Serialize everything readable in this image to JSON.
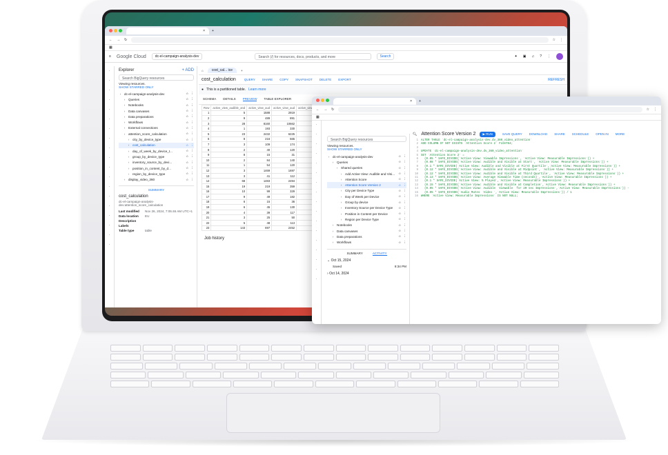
{
  "back_window": {
    "tab_title": "×",
    "url": "",
    "logo": "Google Cloud",
    "project": "dc-el-campaign-analysis-dev",
    "search_placeholder": "Search (/) for resources, docs, products, and more",
    "search_button": "Search",
    "explorer_title": "Explorer",
    "add_label": "+ ADD",
    "explorer_search": "Search BigQuery resources",
    "viewing": "Viewing resources.",
    "show_starred": "SHOW STARRED ONLY",
    "tree": [
      {
        "label": "dc-el-campaign-analysis-dev",
        "indent": 0
      },
      {
        "label": "Queries",
        "indent": 1
      },
      {
        "label": "Notebooks",
        "indent": 1
      },
      {
        "label": "Data canvases",
        "indent": 1
      },
      {
        "label": "Data preparations",
        "indent": 1
      },
      {
        "label": "Workflows",
        "indent": 1
      },
      {
        "label": "External connections",
        "indent": 1
      },
      {
        "label": "attention_score_calculation",
        "indent": 1
      },
      {
        "label": "city_by_device_type",
        "indent": 2
      },
      {
        "label": "cost_calculation",
        "indent": 2,
        "selected": true
      },
      {
        "label": "day_of_week_by_device_t...",
        "indent": 2
      },
      {
        "label": "group_by_device_type",
        "indent": 2
      },
      {
        "label": "inventory_source_by_devi...",
        "indent": 2
      },
      {
        "label": "position_in_content_by_d...",
        "indent": 2
      },
      {
        "label": "region_by_device_type",
        "indent": 2
      },
      {
        "label": "display_video_360",
        "indent": 1
      }
    ],
    "summary_tab": "SUMMARY",
    "summary_title": "cost_calculation",
    "summary_path": "dc-el-campaign-analysis-dev:attention_score_calculation",
    "details": [
      {
        "k": "Last modified",
        "v": "Nov 26, 2024, 7:05:46 AM UTC+1"
      },
      {
        "k": "Data location",
        "v": "EU"
      },
      {
        "k": "Description",
        "v": ""
      },
      {
        "k": "Labels",
        "v": ""
      },
      {
        "k": "Table type",
        "v": "table"
      }
    ],
    "tab_label": "cost_cal... ice",
    "table_title": "cost_calculation",
    "actions": [
      "QUERY",
      "SHARE",
      "COPY",
      "SNAPSHOT",
      "DELETE",
      "EXPORT"
    ],
    "refresh": "REFRESH",
    "partition_note": "This is a partitioned table.",
    "learn_more": "Learn more",
    "subtabs": [
      "SCHEMA",
      "DETAILS",
      "PREVIEW",
      "TABLE EXPLORER"
    ],
    "columns": [
      "Row",
      "active_view_audible_and",
      "active_view_aud",
      "active_view_aud",
      "active_view"
    ],
    "rows": [
      [
        "1",
        "5",
        "1588",
        "2919"
      ],
      [
        "2",
        "9",
        "489",
        "891"
      ],
      [
        "3",
        "28",
        "8160",
        "10662"
      ],
      [
        "4",
        "1",
        "193",
        "330"
      ],
      [
        "5",
        "23",
        "2432",
        "6225"
      ],
      [
        "6",
        "8",
        "216",
        "565"
      ],
      [
        "7",
        "3",
        "109",
        "174"
      ],
      [
        "8",
        "2",
        "40",
        "120"
      ],
      [
        "9",
        "8",
        "15",
        "31"
      ],
      [
        "10",
        "2",
        "84",
        "140"
      ],
      [
        "11",
        "1",
        "54",
        "120"
      ],
      [
        "12",
        "3",
        "1469",
        "1697"
      ],
      [
        "13",
        "3",
        "41",
        "112"
      ],
      [
        "14",
        "68",
        "1483",
        "2494"
      ],
      [
        "15",
        "19",
        "219",
        "359"
      ],
      [
        "16",
        "10",
        "99",
        "329"
      ],
      [
        "17",
        "9",
        "49",
        "182"
      ],
      [
        "18",
        "6",
        "15",
        "36"
      ],
      [
        "19",
        "6",
        "45",
        "130"
      ],
      [
        "20",
        "4",
        "39",
        "117"
      ],
      [
        "21",
        "3",
        "25",
        "50"
      ],
      [
        "22",
        "5",
        "48",
        "113"
      ],
      [
        "23",
        "143",
        "697",
        "2452"
      ]
    ],
    "job_history": "Job history"
  },
  "front_window": {
    "url": "",
    "explorer_search": "Search BigQuery resources",
    "viewing": "Viewing resources.",
    "show_starred": "SHOW STARRED ONLY",
    "tree": [
      {
        "label": "dc-el-campaign-analysis-dev",
        "indent": 0
      },
      {
        "label": "Queries",
        "indent": 1
      },
      {
        "label": "Shared queries",
        "indent": 2
      },
      {
        "label": "Add Active View: Audible and Visible ...",
        "indent": 3
      },
      {
        "label": "Attention Score",
        "indent": 3
      },
      {
        "label": "Attention Score Version 2",
        "indent": 3,
        "selected": true
      },
      {
        "label": "City per Device Type",
        "indent": 3
      },
      {
        "label": "Day of Week per Device",
        "indent": 3
      },
      {
        "label": "Group by device",
        "indent": 3
      },
      {
        "label": "Inventory Source per Device Type",
        "indent": 3
      },
      {
        "label": "Position in Content per Device",
        "indent": 3
      },
      {
        "label": "Region per Device Type",
        "indent": 3
      },
      {
        "label": "Notebooks",
        "indent": 1
      },
      {
        "label": "Data canvases",
        "indent": 1
      },
      {
        "label": "Data preparations",
        "indent": 1
      },
      {
        "label": "Workflows",
        "indent": 1
      }
    ],
    "summary_tab": "SUMMARY",
    "activity_tab": "ACTIVITY",
    "dates": [
      {
        "label": "Oct 15, 2024"
      },
      {
        "label": "Oct 14, 2024"
      }
    ],
    "saved_label": "Saved",
    "saved_time": "8:34 PM",
    "query_title": "Attention Score Version 2",
    "run": "RUN",
    "actions": [
      "SAVE QUERY",
      "DOWNLOAD",
      "SHARE",
      "SCHEDULE",
      "OPEN IN",
      "MORE"
    ],
    "code": [
      "ALTER TABLE `dc-el-campaign-analysis-dev.dv_360_video_attention`",
      "ADD COLUMN IF NOT EXISTS `Attention Score 2` FLOAT64;",
      "",
      "UPDATE `dc-el-campaign-analysis-dev.dv_360_video_attention`",
      "SET `Attention Score 2` =",
      "  (0.05 * SAFE_DIVIDE(`Active View: Viewable Impressions`, `Active View: Measurable Impressions`)) +",
      "  (0.08 * SAFE_DIVIDE(`Active View: Audible and Visible at Start`, `Active View: Measurable Impressions`)) +",
      "  (0.1 * SAFE_DIVIDE(`Active View: Audible and Visible at First Quartile`,`Active View: Measurable Impressions`)) +",
      "  (0.12 * SAFE_DIVIDE(`Active View: Audible and Visible at Midpoint`, `Active View: Measurable Impressions`)) +",
      "  (0.12 * SAFE_DIVIDE(`Active View: Audible and Visible at Third Quartile`, `Active View: Measurable Impressions`)) +",
      "  (0.13 * SAFE_DIVIDE(`Active View: Average Viewable Time (seconds)`,`Active View: Measurable Impressions`)) +",
      "  (0.1 * SAFE_DIVIDE(`Active View: % Played`,`Active View: Measurable Impressions`)) +",
      "  (0.15 * SAFE_DIVIDE(`Active View: Audible and Visible at Completion`,`Active View: Measurable Impressions`)) +",
      "  (0.05 * SAFE_DIVIDE(`Active View: Audible  Viewable  for 20 sec Impressions`,`Active View: Measurable Impressions`)) -",
      "  (0.05 * SAFE_DIVIDE(`Audio Mutes  Video `,`Active View: Measurable Impressions`)) / 1",
      "WHERE `Active View: Measurable Impressions` IS NOT NULL;"
    ]
  },
  "colors": {
    "accent": "#1a73e8",
    "selected_bg": "#e8f0fe",
    "code_green": "#1e8e3e"
  }
}
